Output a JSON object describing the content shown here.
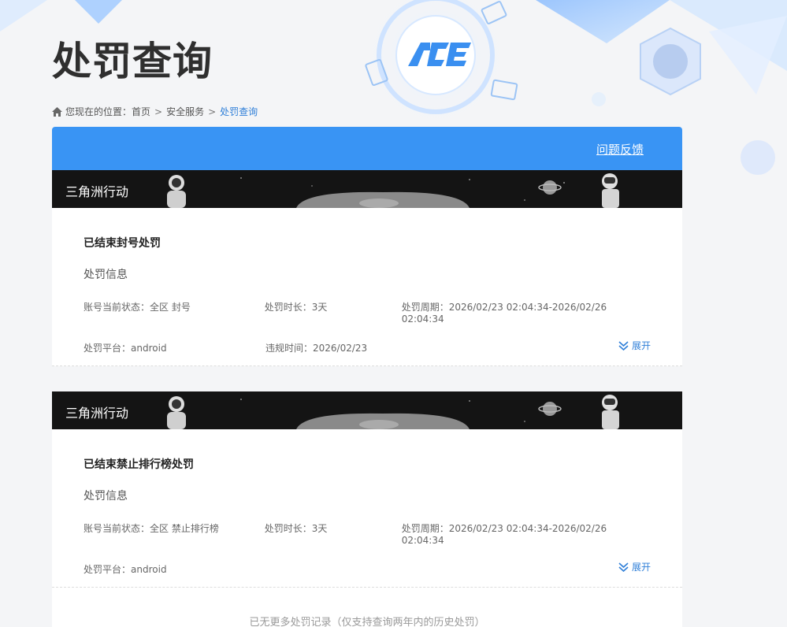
{
  "page": {
    "title": "处罚查询"
  },
  "breadcrumb": {
    "prefix": "您现在的位置：",
    "items": [
      "首页",
      "安全服务"
    ],
    "separator": ">",
    "current": "处罚查询"
  },
  "header_bar": {
    "feedback_link": "问题反馈"
  },
  "logo": {
    "text": "ACE"
  },
  "records": [
    {
      "game": "三角洲行动",
      "title": "已结束封号处罚",
      "section": "处罚信息",
      "fields_row1": [
        {
          "label": "账号当前状态：",
          "value": "全区 封号"
        },
        {
          "label": "处罚时长：",
          "value": "3天"
        },
        {
          "label": "处罚周期：",
          "value": "2026/02/23 02:04:34-2026/02/26 02:04:34"
        }
      ],
      "fields_row2": [
        {
          "label": "处罚平台：",
          "value": "android"
        },
        {
          "label": "违规时间：",
          "value": "2026/02/23"
        }
      ],
      "expand_label": "展开"
    },
    {
      "game": "三角洲行动",
      "title": "已结束禁止排行榜处罚",
      "section": "处罚信息",
      "fields_row1": [
        {
          "label": "账号当前状态：",
          "value": "全区 禁止排行榜"
        },
        {
          "label": "处罚时长：",
          "value": "3天"
        },
        {
          "label": "处罚周期：",
          "value": "2026/02/23 02:04:34-2026/02/26 02:04:34"
        }
      ],
      "fields_row2": [
        {
          "label": "处罚平台：",
          "value": "android"
        }
      ],
      "expand_label": "展开"
    }
  ],
  "footer_note": "已无更多处罚记录（仅支持查询两年内的历史处罚）",
  "colors": {
    "accent": "#3994f4",
    "link": "#2f7fd8",
    "title": "#2f2f2f"
  },
  "icons": [
    "home-icon",
    "double-chevron-down-icon",
    "astronaut-icon",
    "planet-icon"
  ]
}
